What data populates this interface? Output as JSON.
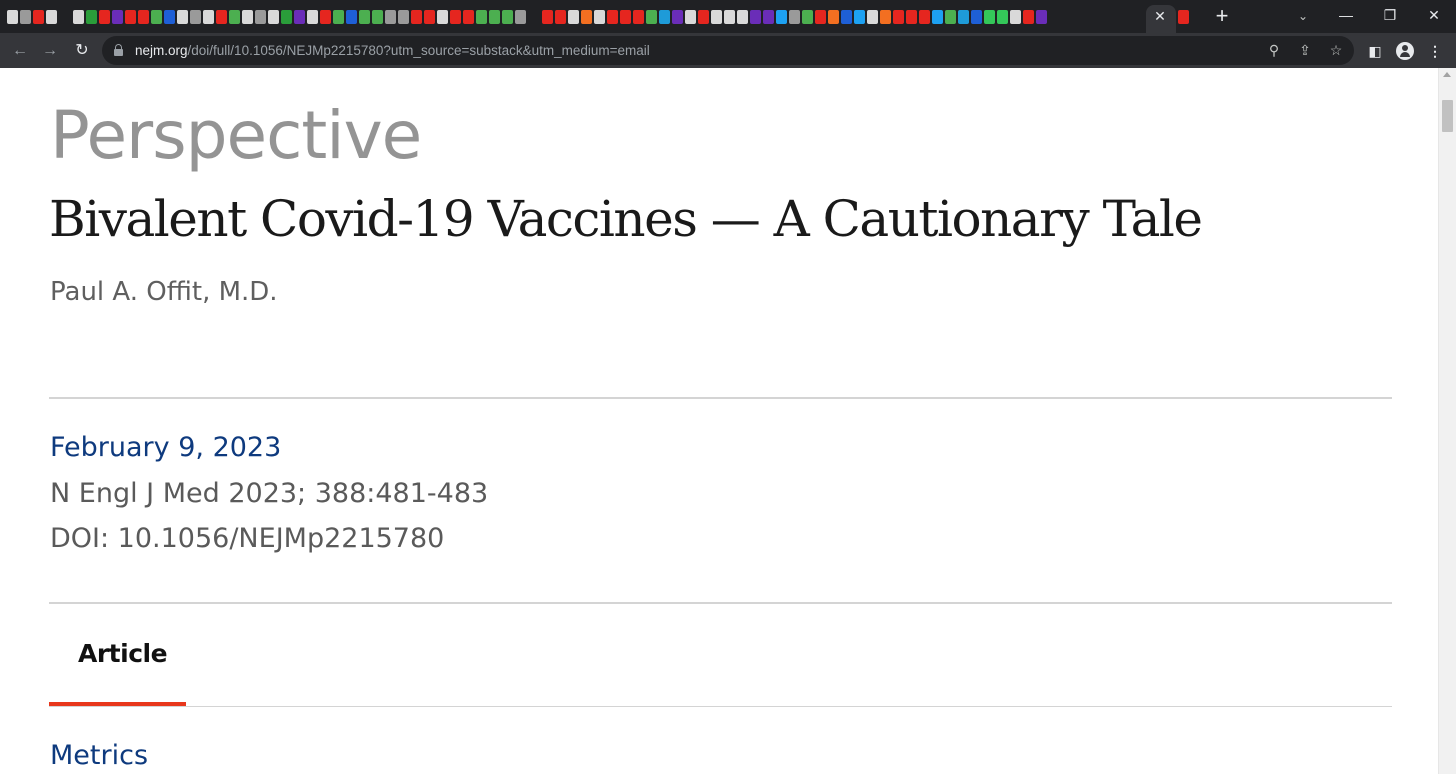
{
  "browser": {
    "tab_strip": {
      "favicon_colors": [
        "#d9d9d9",
        "#9a9a9a",
        "#e5261f",
        "#d9d9d9",
        "#d9d9d9",
        "#2a9d3a",
        "#e5261f",
        "#6a2db8",
        "#e5261f",
        "#e5261f",
        "#4caf50",
        "#1e5fd6",
        "#d9d9d9",
        "#9a9a9a",
        "#d9d9d9",
        "#e5261f",
        "#4caf50",
        "#d9d9d9",
        "#9a9a9a",
        "#d9d9d9",
        "#2a9d3a",
        "#6a2db8",
        "#d9d9d9",
        "#e5261f",
        "#4caf50",
        "#1e5fd6",
        "#4caf50",
        "#4caf50",
        "#9a9a9a",
        "#9a9a9a",
        "#e5261f",
        "#e5261f",
        "#d9d9d9",
        "#e5261f",
        "#e5261f",
        "#4caf50",
        "#4caf50",
        "#4caf50",
        "#9a9a9a",
        "#e5261f",
        "#e5261f",
        "#d9d9d9",
        "#f36f21",
        "#d9d9d9",
        "#e5261f",
        "#e5261f",
        "#e5261f",
        "#4caf50",
        "#1e9bd8",
        "#6a2db8",
        "#d9d9d9",
        "#e5261f",
        "#d9d9d9",
        "#d9d9d9",
        "#d9d9d9",
        "#6a2db8",
        "#6a2db8",
        "#1da1f2",
        "#9a9a9a",
        "#4caf50",
        "#e5261f",
        "#f36f21",
        "#1e5fd6",
        "#1da1f2",
        "#d9d9d9",
        "#f36f21",
        "#e5261f",
        "#e5261f",
        "#e5261f",
        "#1da1f2",
        "#4caf50",
        "#1e9bd8",
        "#1e5fd6",
        "#34c759",
        "#34c759",
        "#d9d9d9",
        "#e5261f",
        "#6a2db8"
      ],
      "active_tab_close": "✕",
      "active_tab_favicon_color": "#e5261f",
      "new_tab": "+",
      "tab_search": "⌄",
      "window_controls": {
        "minimize": "—",
        "maximize": "❐",
        "close": "✕"
      }
    },
    "toolbar": {
      "back": "←",
      "forward": "→",
      "reload": "↻",
      "url_host": "nejm.org",
      "url_path": "/doi/full/10.1056/NEJMp2215780?utm_source=substack&utm_medium=email",
      "zoom": "⚲",
      "share": "⇪",
      "bookmark": "☆",
      "side_panel": "◧",
      "menu": "⋮"
    }
  },
  "article": {
    "type": "Perspective",
    "title": "Bivalent Covid-19 Vaccines — A Cautionary Tale",
    "author": "Paul A. Offit, M.D.",
    "date": "February 9, 2023",
    "citation": "N Engl J Med 2023; 388:481-483",
    "doi": "DOI: 10.1056/NEJMp2215780",
    "tabs": [
      {
        "label": "Article",
        "active": true
      }
    ],
    "metrics_link": "Metrics"
  },
  "colors": {
    "chrome_dark": "#202124",
    "toolbar": "#35363a",
    "link_blue": "#0e3a7e",
    "active_tab_accent": "#e8371c"
  }
}
